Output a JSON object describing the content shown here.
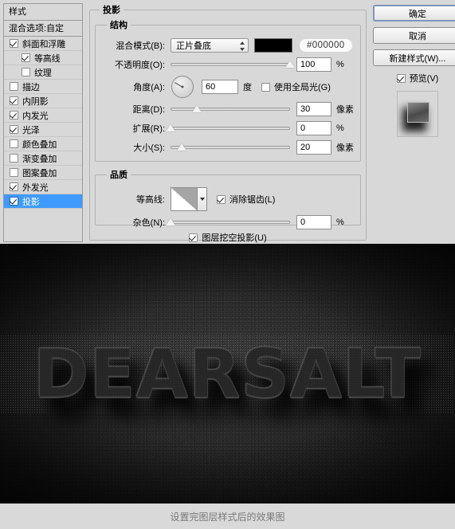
{
  "dialog": {
    "sidebar": {
      "title": "样式",
      "blending_options": "混合选项:自定",
      "items": [
        {
          "label": "斜面和浮雕",
          "checked": true,
          "indent": false,
          "selected": false
        },
        {
          "label": "等高线",
          "checked": true,
          "indent": true,
          "selected": false
        },
        {
          "label": "纹理",
          "checked": false,
          "indent": true,
          "selected": false
        },
        {
          "label": "描边",
          "checked": false,
          "indent": false,
          "selected": false
        },
        {
          "label": "内阴影",
          "checked": true,
          "indent": false,
          "selected": false
        },
        {
          "label": "内发光",
          "checked": true,
          "indent": false,
          "selected": false
        },
        {
          "label": "光泽",
          "checked": true,
          "indent": false,
          "selected": false
        },
        {
          "label": "颜色叠加",
          "checked": false,
          "indent": false,
          "selected": false
        },
        {
          "label": "渐变叠加",
          "checked": false,
          "indent": false,
          "selected": false
        },
        {
          "label": "图案叠加",
          "checked": false,
          "indent": false,
          "selected": false
        },
        {
          "label": "外发光",
          "checked": true,
          "indent": false,
          "selected": false
        },
        {
          "label": "投影",
          "checked": true,
          "indent": false,
          "selected": true
        }
      ]
    },
    "panel": {
      "title": "投影",
      "structure": {
        "legend": "结构",
        "blend_mode_label": "混合模式(B):",
        "blend_mode_value": "正片叠底",
        "color_hex": "#000000",
        "color_swatch": "#000000",
        "opacity_label": "不透明度(O):",
        "opacity_value": "100",
        "opacity_unit": "%",
        "opacity_pct": 100,
        "angle_label": "角度(A):",
        "angle_value": "60",
        "angle_unit": "度",
        "use_global_light_label": "使用全局光(G)",
        "use_global_light_checked": false,
        "distance_label": "距离(D):",
        "distance_value": "30",
        "distance_unit": "像素",
        "distance_pct": 22,
        "spread_label": "扩展(R):",
        "spread_value": "0",
        "spread_unit": "%",
        "spread_pct": 0,
        "size_label": "大小(S):",
        "size_value": "20",
        "size_unit": "像素",
        "size_pct": 9
      },
      "quality": {
        "legend": "品质",
        "contour_label": "等高线:",
        "antialias_label": "消除锯齿(L)",
        "antialias_checked": true,
        "noise_label": "杂色(N):",
        "noise_value": "0",
        "noise_unit": "%",
        "noise_pct": 0
      },
      "knockout_label": "图层挖空投影(U)",
      "knockout_checked": true
    },
    "buttons": {
      "ok": "确定",
      "cancel": "取消",
      "new_style": "新建样式(W)...",
      "preview_label": "预览(V)",
      "preview_checked": true
    }
  },
  "artwork": {
    "text": "DEARSALT"
  },
  "caption": "设置完图层样式后的效果图"
}
